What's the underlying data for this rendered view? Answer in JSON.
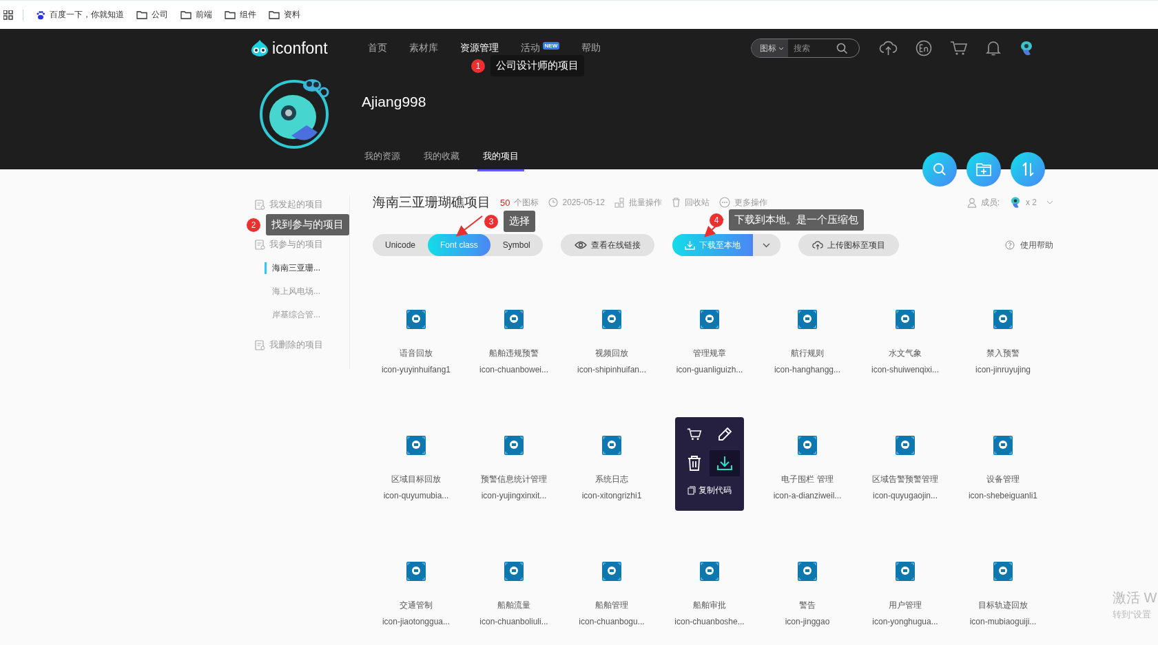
{
  "bookmarks": [
    {
      "kind": "site",
      "label": "百度一下，你就知道"
    },
    {
      "kind": "folder",
      "label": "公司"
    },
    {
      "kind": "folder",
      "label": "前端"
    },
    {
      "kind": "folder",
      "label": "组件"
    },
    {
      "kind": "folder",
      "label": "资料"
    }
  ],
  "header": {
    "logo": "iconfont",
    "nav": [
      {
        "label": "首页",
        "selected": false
      },
      {
        "label": "素材库",
        "selected": false
      },
      {
        "label": "资源管理",
        "selected": true
      },
      {
        "label": "活动",
        "selected": false,
        "badge": "NEW"
      },
      {
        "label": "帮助",
        "selected": false
      }
    ],
    "search": {
      "scope": "图标",
      "placeholder": "搜索"
    },
    "username": "Ajiang998",
    "tabs": [
      {
        "label": "我的资源",
        "selected": false
      },
      {
        "label": "我的收藏",
        "selected": false
      },
      {
        "label": "我的项目",
        "selected": true
      }
    ]
  },
  "sidebar": [
    {
      "label": "我发起的项目"
    },
    {
      "label": "我参与的项目",
      "children": [
        {
          "label": "海南三亚珊...",
          "selected": true
        },
        {
          "label": "海上风电场...",
          "selected": false
        },
        {
          "label": "岸基综合管...",
          "selected": false
        }
      ]
    },
    {
      "label": "我删除的项目"
    }
  ],
  "project": {
    "title": "海南三亚珊瑚礁项目",
    "count": "50",
    "count_label": "个图标",
    "date": "2025-05-12",
    "batch": "批量操作",
    "trash": "回收站",
    "more": "更多操作",
    "members_label": "成员:",
    "members_count": "x 2",
    "formats": [
      {
        "label": "Unicode",
        "selected": false
      },
      {
        "label": "Font class",
        "selected": true
      },
      {
        "label": "Symbol",
        "selected": false
      }
    ],
    "view_link": "查看在线链接",
    "download": "下载至本地",
    "upload": "上传图标至项目",
    "help": "使用帮助"
  },
  "icons": [
    {
      "kind": "icon",
      "name": "语音回放",
      "code": "icon-yuyinhuifang1"
    },
    {
      "kind": "icon",
      "name": "船舶违规预警",
      "code": "icon-chuanbowei..."
    },
    {
      "kind": "icon",
      "name": "视频回放",
      "code": "icon-shipinhuifan..."
    },
    {
      "kind": "icon",
      "name": "管理规章",
      "code": "icon-guanliguizh..."
    },
    {
      "kind": "icon",
      "name": "航行规则",
      "code": "icon-hanghangg..."
    },
    {
      "kind": "icon",
      "name": "水文气象",
      "code": "icon-shuiwenqixi..."
    },
    {
      "kind": "icon",
      "name": "禁入预警",
      "code": "icon-jinruyujing"
    },
    {
      "kind": "icon",
      "name": "区域目标回放",
      "code": "icon-quyumubia..."
    },
    {
      "kind": "icon",
      "name": "预警信息统计管理",
      "code": "icon-yujingxinxit..."
    },
    {
      "kind": "icon",
      "name": "系统日志",
      "code": "icon-xitongrizhi1"
    },
    {
      "kind": "hover",
      "copy_label": "复制代码"
    },
    {
      "kind": "icon",
      "name": "电子围栏 管理",
      "code": "icon-a-dianziweil..."
    },
    {
      "kind": "icon",
      "name": "区域告警预警管理",
      "code": "icon-quyugaojin..."
    },
    {
      "kind": "icon",
      "name": "设备管理",
      "code": "icon-shebeiguanli1"
    },
    {
      "kind": "icon",
      "name": "交通管制",
      "code": "icon-jiaotonggua..."
    },
    {
      "kind": "icon",
      "name": "船舶流量",
      "code": "icon-chuanboliuli..."
    },
    {
      "kind": "icon",
      "name": "船舶管理",
      "code": "icon-chuanbogu..."
    },
    {
      "kind": "icon",
      "name": "船舶审批",
      "code": "icon-chuanboshe..."
    },
    {
      "kind": "icon",
      "name": "警告",
      "code": "icon-jinggao"
    },
    {
      "kind": "icon",
      "name": "用户管理",
      "code": "icon-yonghugua..."
    },
    {
      "kind": "icon",
      "name": "目标轨迹回放",
      "code": "icon-mubiaoguiji..."
    }
  ],
  "annotations": [
    {
      "number": "1",
      "text": "公司设计师的项目"
    },
    {
      "number": "2",
      "text": "找到参与的项目"
    },
    {
      "number": "3",
      "text": "选择"
    },
    {
      "number": "4",
      "text": "下载到本地。是一个压缩包"
    }
  ],
  "activation": {
    "line1": "激活 W",
    "line2": "转到“设置"
  }
}
